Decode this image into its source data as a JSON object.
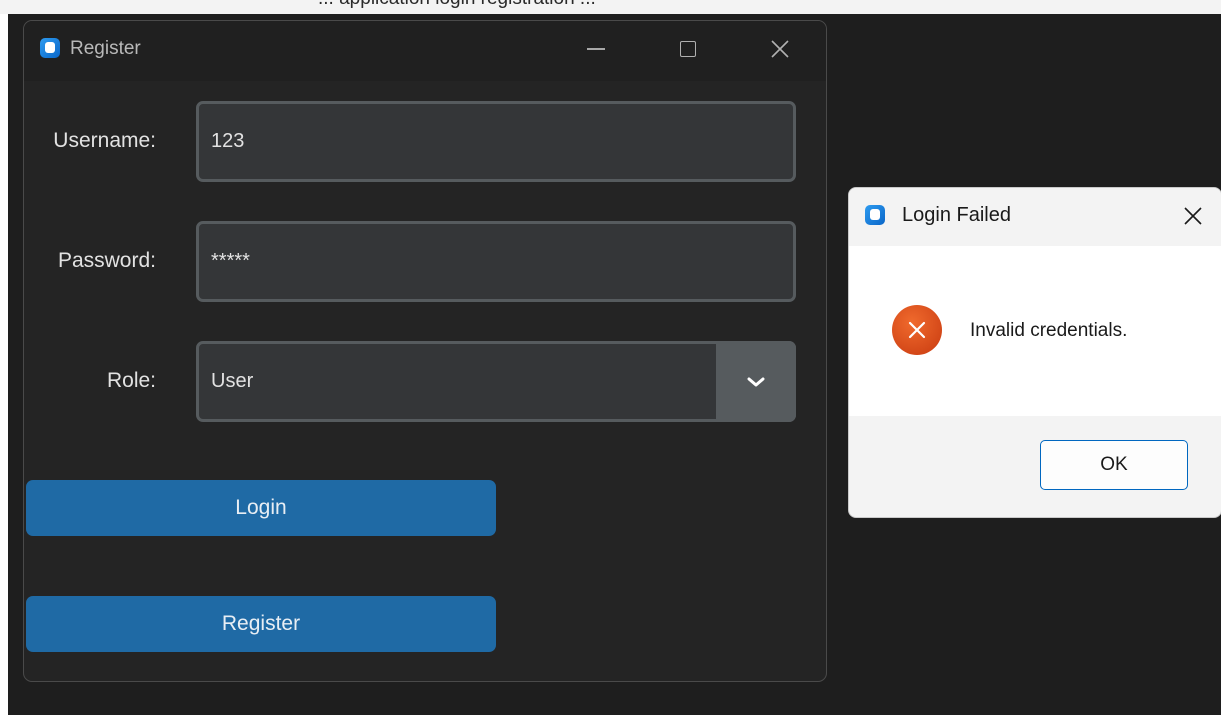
{
  "desktop": {
    "partial_text": "... application login registration ..."
  },
  "main_window": {
    "title": "Register",
    "form": {
      "username_label": "Username:",
      "username_value": "123",
      "password_label": "Password:",
      "password_value": "*****",
      "role_label": "Role:",
      "role_value": "User"
    },
    "buttons": {
      "login": "Login",
      "register": "Register"
    },
    "colors": {
      "accent": "#1f6aa5",
      "background": "#242424",
      "field": "#343638"
    }
  },
  "dialog": {
    "title": "Login Failed",
    "message": "Invalid credentials.",
    "ok_label": "OK",
    "icon": "error-icon",
    "colors": {
      "error": "#d9481a",
      "ok_border": "#0067c0"
    }
  }
}
